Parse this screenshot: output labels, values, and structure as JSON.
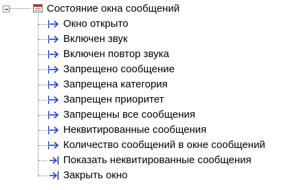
{
  "tree": {
    "root": {
      "label": "Состояние окна сообщений",
      "icon": "window-state-icon",
      "expanded": true
    },
    "items": [
      {
        "label": "Окно открыто",
        "icon": "arrow-in-icon"
      },
      {
        "label": "Включен звук",
        "icon": "arrow-in-icon"
      },
      {
        "label": "Включен повтор звука",
        "icon": "arrow-in-icon"
      },
      {
        "label": "Запрещено сообщение",
        "icon": "arrow-in-icon"
      },
      {
        "label": "Запрещена категория",
        "icon": "arrow-in-icon"
      },
      {
        "label": "Запрещен приоритет",
        "icon": "arrow-in-icon"
      },
      {
        "label": "Запрещены все сообщения",
        "icon": "arrow-in-icon"
      },
      {
        "label": "Неквитированные сообщения",
        "icon": "arrow-in-icon"
      },
      {
        "label": "Количество сообщений в окне сообщений",
        "icon": "arrow-in-icon"
      },
      {
        "label": "Показать неквитированные сообщения",
        "icon": "arrow-out-icon"
      },
      {
        "label": "Закрыть окно",
        "icon": "arrow-out-icon"
      }
    ]
  },
  "colors": {
    "arrow_blue": "#1c39d8",
    "connector": "#7a7a7a",
    "icon_red": "#c8322b"
  }
}
